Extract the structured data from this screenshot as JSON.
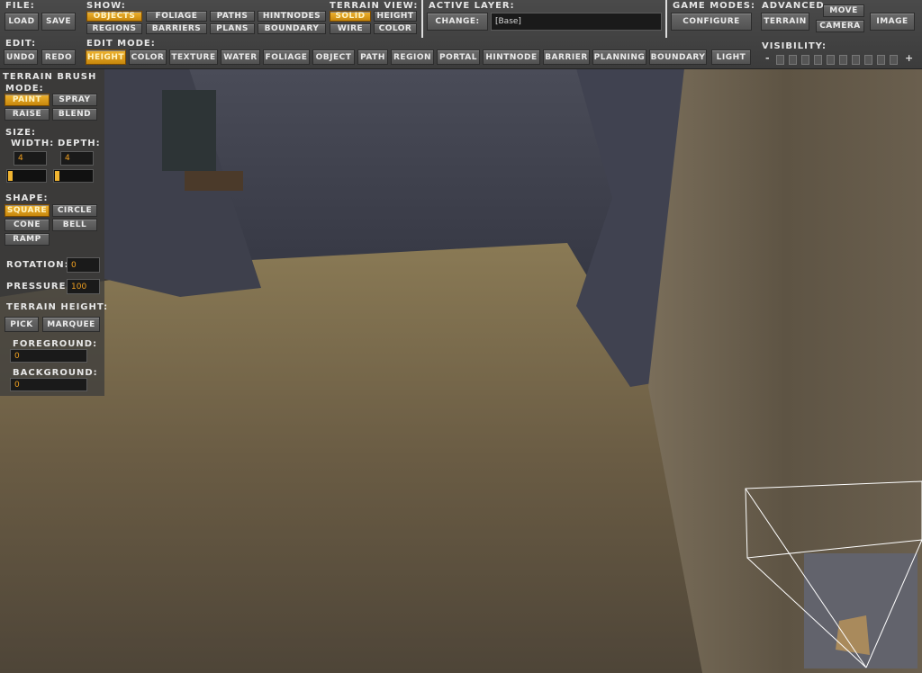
{
  "file": {
    "label": "File:",
    "load": "Load",
    "save": "Save"
  },
  "show": {
    "label": "Show:",
    "items": [
      "Objects",
      "Foliage",
      "Paths",
      "HintNodes",
      "Regions",
      "Barriers",
      "Plans",
      "Boundary"
    ],
    "active": "Objects"
  },
  "terrain_view": {
    "label": "Terrain View:",
    "items": [
      "Solid",
      "Height",
      "Wire",
      "Color"
    ],
    "active": "Solid"
  },
  "active_layer": {
    "label": "Active Layer:",
    "change": "Change:",
    "value": "[Base]"
  },
  "game_modes": {
    "label": "Game Modes:",
    "configure": "Configure"
  },
  "advanced": {
    "label": "Advanced",
    "terrain": "Terrain",
    "move": "Move",
    "camera": "Camera",
    "image": "Image"
  },
  "edit": {
    "label": "Edit:",
    "undo": "Undo",
    "redo": "Redo"
  },
  "edit_mode": {
    "label": "Edit Mode:",
    "items": [
      "Height",
      "Color",
      "Texture",
      "Water",
      "Foliage",
      "Object",
      "Path",
      "Region",
      "Portal",
      "HintNode",
      "Barrier",
      "Planning",
      "Boundary",
      "Light"
    ],
    "active": "Height"
  },
  "visibility": {
    "label": "Visibility:",
    "minus": "-",
    "plus": "+"
  },
  "brush": {
    "title": "Terrain Brush",
    "mode_label": "Mode:",
    "modes": [
      "Paint",
      "Spray",
      "Raise",
      "Blend"
    ],
    "active_mode": "Paint",
    "size_label": "Size:",
    "width_label": "Width:",
    "depth_label": "Depth:",
    "width": "4",
    "depth": "4",
    "shape_label": "Shape:",
    "shapes": [
      "Square",
      "Circle",
      "Cone",
      "Bell",
      "Ramp"
    ],
    "active_shape": "Square",
    "rotation_label": "Rotation:",
    "rotation": "0",
    "pressure_label": "Pressure:",
    "pressure": "100",
    "height_label": "Terrain Height:",
    "pick": "Pick",
    "marquee": "Marquee",
    "foreground_label": "Foreground:",
    "foreground": "0",
    "background_label": "Background:",
    "background": "0"
  },
  "colors": {
    "accent": "#f0b431",
    "panel": "#4a4a4a"
  }
}
